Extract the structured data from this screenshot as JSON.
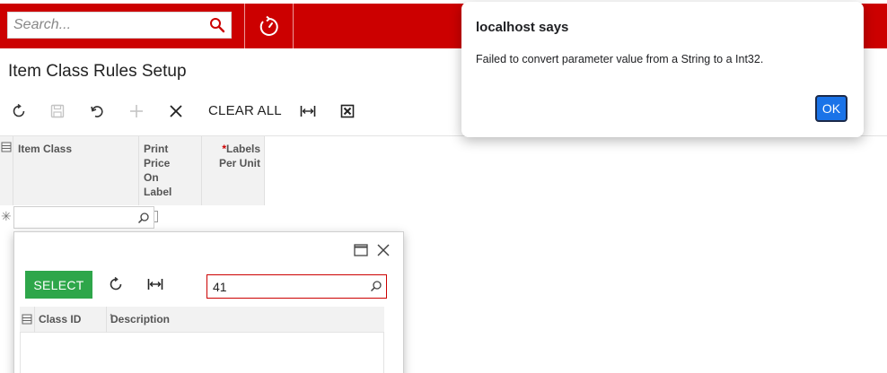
{
  "header": {
    "search_placeholder": "Search...",
    "search_icon": "search-icon",
    "history_icon": "history-icon",
    "bar_color": "#cc0000"
  },
  "page": {
    "title": "Item Class Rules Setup"
  },
  "toolbar": {
    "buttons": [
      {
        "icon": "refresh-icon",
        "enabled": true
      },
      {
        "icon": "save-icon",
        "enabled": false
      },
      {
        "icon": "undo-icon",
        "enabled": true
      },
      {
        "icon": "add-icon",
        "enabled": false
      },
      {
        "icon": "delete-icon",
        "enabled": true
      }
    ],
    "clear_all_label": "CLEAR ALL",
    "fit_icon": "fit-columns-icon",
    "export_icon": "excel-export-icon"
  },
  "grid": {
    "columns": [
      {
        "label": "Item Class",
        "required": false
      },
      {
        "label": "Print Price On Label",
        "required": false
      },
      {
        "label": "Labels Per Unit",
        "required": true
      }
    ],
    "required_marker": "*",
    "new_row_marker": "✳",
    "item_class_value": ""
  },
  "lookup_popup": {
    "select_label": "SELECT",
    "search_value": "41",
    "columns": [
      {
        "label": "Class ID",
        "sort": "↑"
      },
      {
        "label": "Description"
      }
    ],
    "select_color": "#2ea64a"
  },
  "alert": {
    "title": "localhost says",
    "message": "Failed to convert parameter value from a String to a Int32.",
    "ok_label": "OK",
    "ok_color": "#1a73e8"
  }
}
